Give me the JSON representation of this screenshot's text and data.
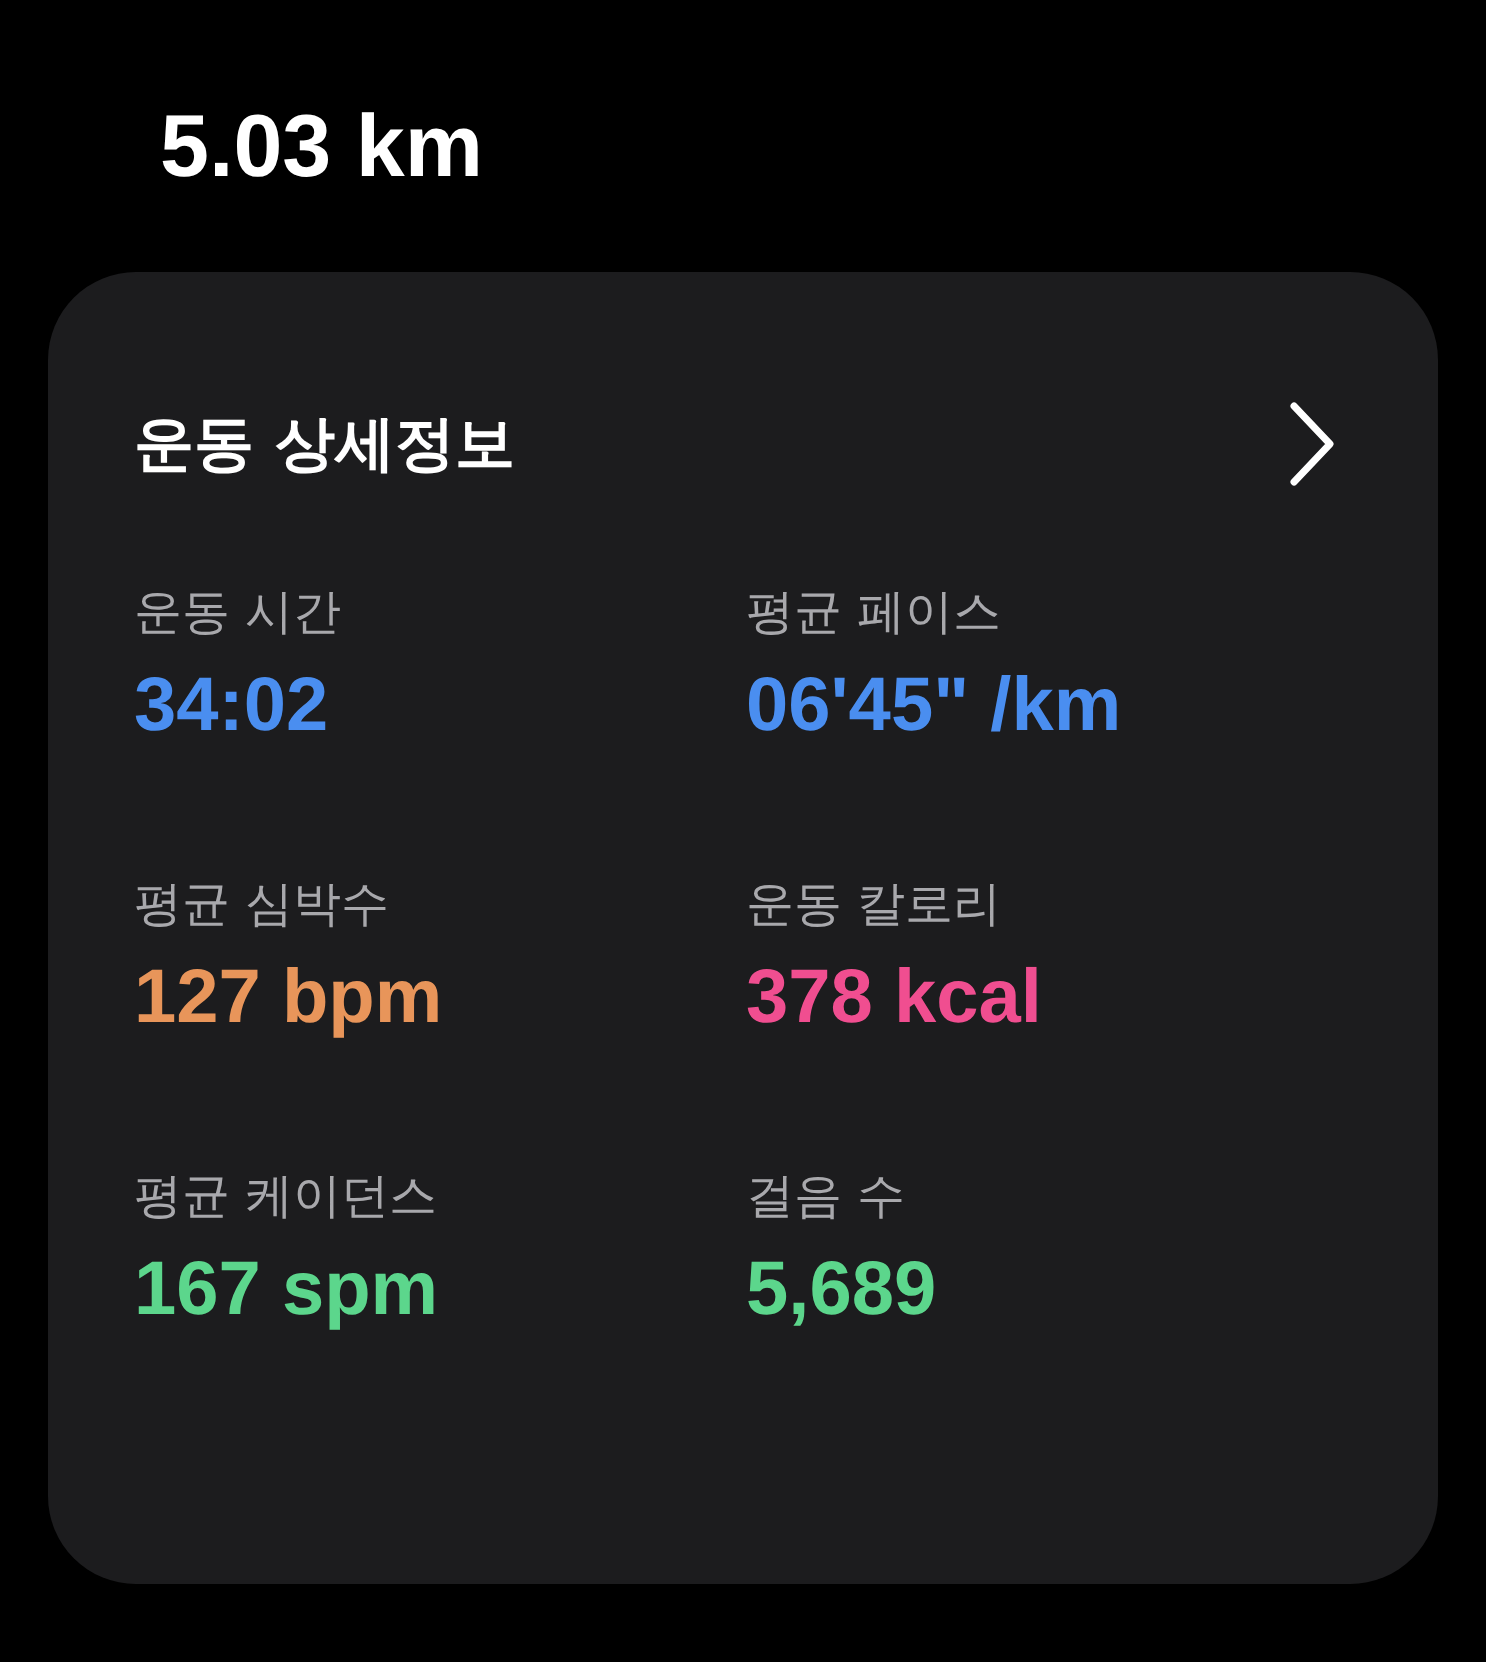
{
  "distance": "5.03 km",
  "card": {
    "title": "운동 상세정보",
    "stats": [
      {
        "label": "운동 시간",
        "value": "34:02",
        "color": "#4a8ef0"
      },
      {
        "label": "평균 페이스",
        "value": "06'45\" /km",
        "color": "#4a8ef0"
      },
      {
        "label": "평균 심박수",
        "value": "127 bpm",
        "color": "#e8955a"
      },
      {
        "label": "운동 칼로리",
        "value": "378 kcal",
        "color": "#f04e90"
      },
      {
        "label": "평균 케이던스",
        "value": "167 spm",
        "color": "#5cd68c"
      },
      {
        "label": "걸음 수",
        "value": "5,689",
        "color": "#5cd68c"
      }
    ]
  }
}
